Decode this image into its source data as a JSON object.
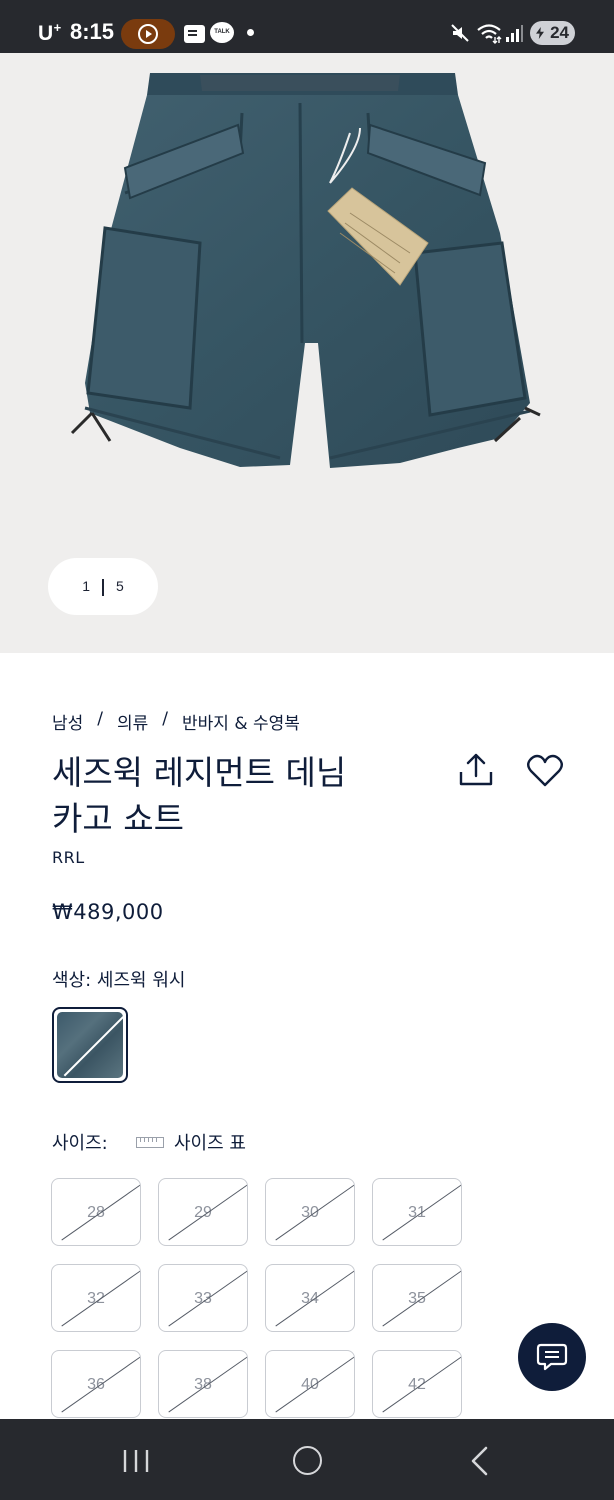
{
  "status_bar": {
    "carrier": "U",
    "carrier_sup": "+",
    "time": "8:15",
    "talk_label": "TALK",
    "battery": "24"
  },
  "gallery": {
    "current": "1",
    "total": "5"
  },
  "breadcrumb": [
    "남성",
    "의류",
    "반바지 & 수영복"
  ],
  "breadcrumb_separator": "/",
  "product": {
    "title_line1": "세즈윅 레지먼트 데님",
    "title_line2": "카고 쇼트",
    "brand": "RRL",
    "price": "₩489,000"
  },
  "color": {
    "label": "색상:",
    "selected": "세즈윅 워시"
  },
  "size": {
    "label": "사이즈:",
    "chart_label": "사이즈 표",
    "options": [
      "28",
      "29",
      "30",
      "31",
      "32",
      "33",
      "34",
      "35",
      "36",
      "38",
      "40",
      "42"
    ]
  },
  "icons": {
    "share": "share-icon",
    "wishlist": "heart-icon",
    "chat": "chat-icon",
    "ruler": "ruler-icon"
  },
  "colors": {
    "navy": "#0f1d3a",
    "hero_bg": "#efeeed",
    "status_bar": "#27292e"
  }
}
